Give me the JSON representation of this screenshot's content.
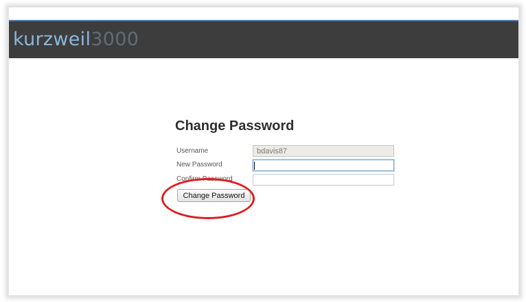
{
  "header": {
    "logo_word": "kurzweil",
    "logo_number": "3000"
  },
  "form": {
    "title": "Change Password",
    "username_label": "Username",
    "username_value": "bdavis87",
    "new_password_label": "New Password",
    "new_password_value": "",
    "confirm_password_label": "Confirm Password",
    "confirm_password_value": "",
    "submit_label": "Change Password"
  },
  "colors": {
    "header_bg": "#3d3d3d",
    "logo_word": "#8ab8dc",
    "logo_number": "#5e6e7a",
    "annotation": "#e01b1b"
  }
}
